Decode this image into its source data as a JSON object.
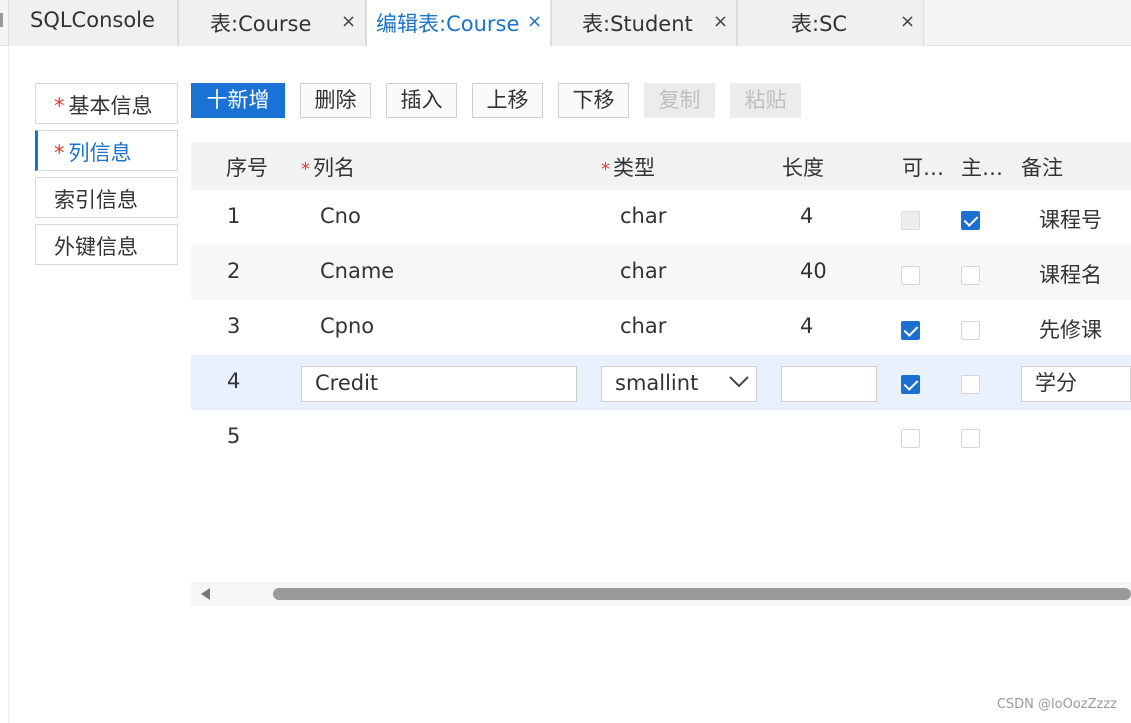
{
  "tabs": [
    {
      "label": "SQLConsole",
      "closable": false,
      "active": false
    },
    {
      "label": "表:Course",
      "closable": true,
      "active": false
    },
    {
      "label": "编辑表:Course",
      "closable": true,
      "active": true
    },
    {
      "label": "表:Student",
      "closable": true,
      "active": false
    },
    {
      "label": "表:SC",
      "closable": true,
      "active": false
    }
  ],
  "close_glyph": "×",
  "nav": [
    {
      "label": "基本信息",
      "required": true,
      "active": false
    },
    {
      "label": "列信息",
      "required": true,
      "active": true
    },
    {
      "label": "索引信息",
      "required": false,
      "active": false
    },
    {
      "label": "外键信息",
      "required": false,
      "active": false
    }
  ],
  "required_mark": "*",
  "toolbar": {
    "add": "十新增",
    "delete": "删除",
    "insert": "插入",
    "move_up": "上移",
    "move_down": "下移",
    "copy": "复制",
    "paste": "粘贴"
  },
  "grid": {
    "headers": {
      "seq": "序号",
      "name": "列名",
      "type": "类型",
      "length": "长度",
      "nullable": "可…",
      "primary": "主…",
      "comment": "备注"
    },
    "rows": [
      {
        "seq": "1",
        "name": "Cno",
        "type": "char",
        "length": "4",
        "nullable": "disabled",
        "primary": true,
        "comment": "课程号"
      },
      {
        "seq": "2",
        "name": "Cname",
        "type": "char",
        "length": "40",
        "nullable": false,
        "primary": false,
        "comment": "课程名"
      },
      {
        "seq": "3",
        "name": "Cpno",
        "type": "char",
        "length": "4",
        "nullable": true,
        "primary": false,
        "comment": "先修课"
      },
      {
        "seq": "4",
        "name": "Credit",
        "type": "smallint",
        "length": "",
        "nullable": true,
        "primary": false,
        "comment": "学分",
        "editing": true
      },
      {
        "seq": "5",
        "name": "",
        "type": "",
        "length": "",
        "nullable": false,
        "primary": false,
        "comment": ""
      }
    ]
  },
  "watermark": "CSDN @loOozZzzz",
  "colors": {
    "accent": "#1a73c8",
    "required": "#e03c31",
    "selected_row": "#e8f1fd"
  }
}
